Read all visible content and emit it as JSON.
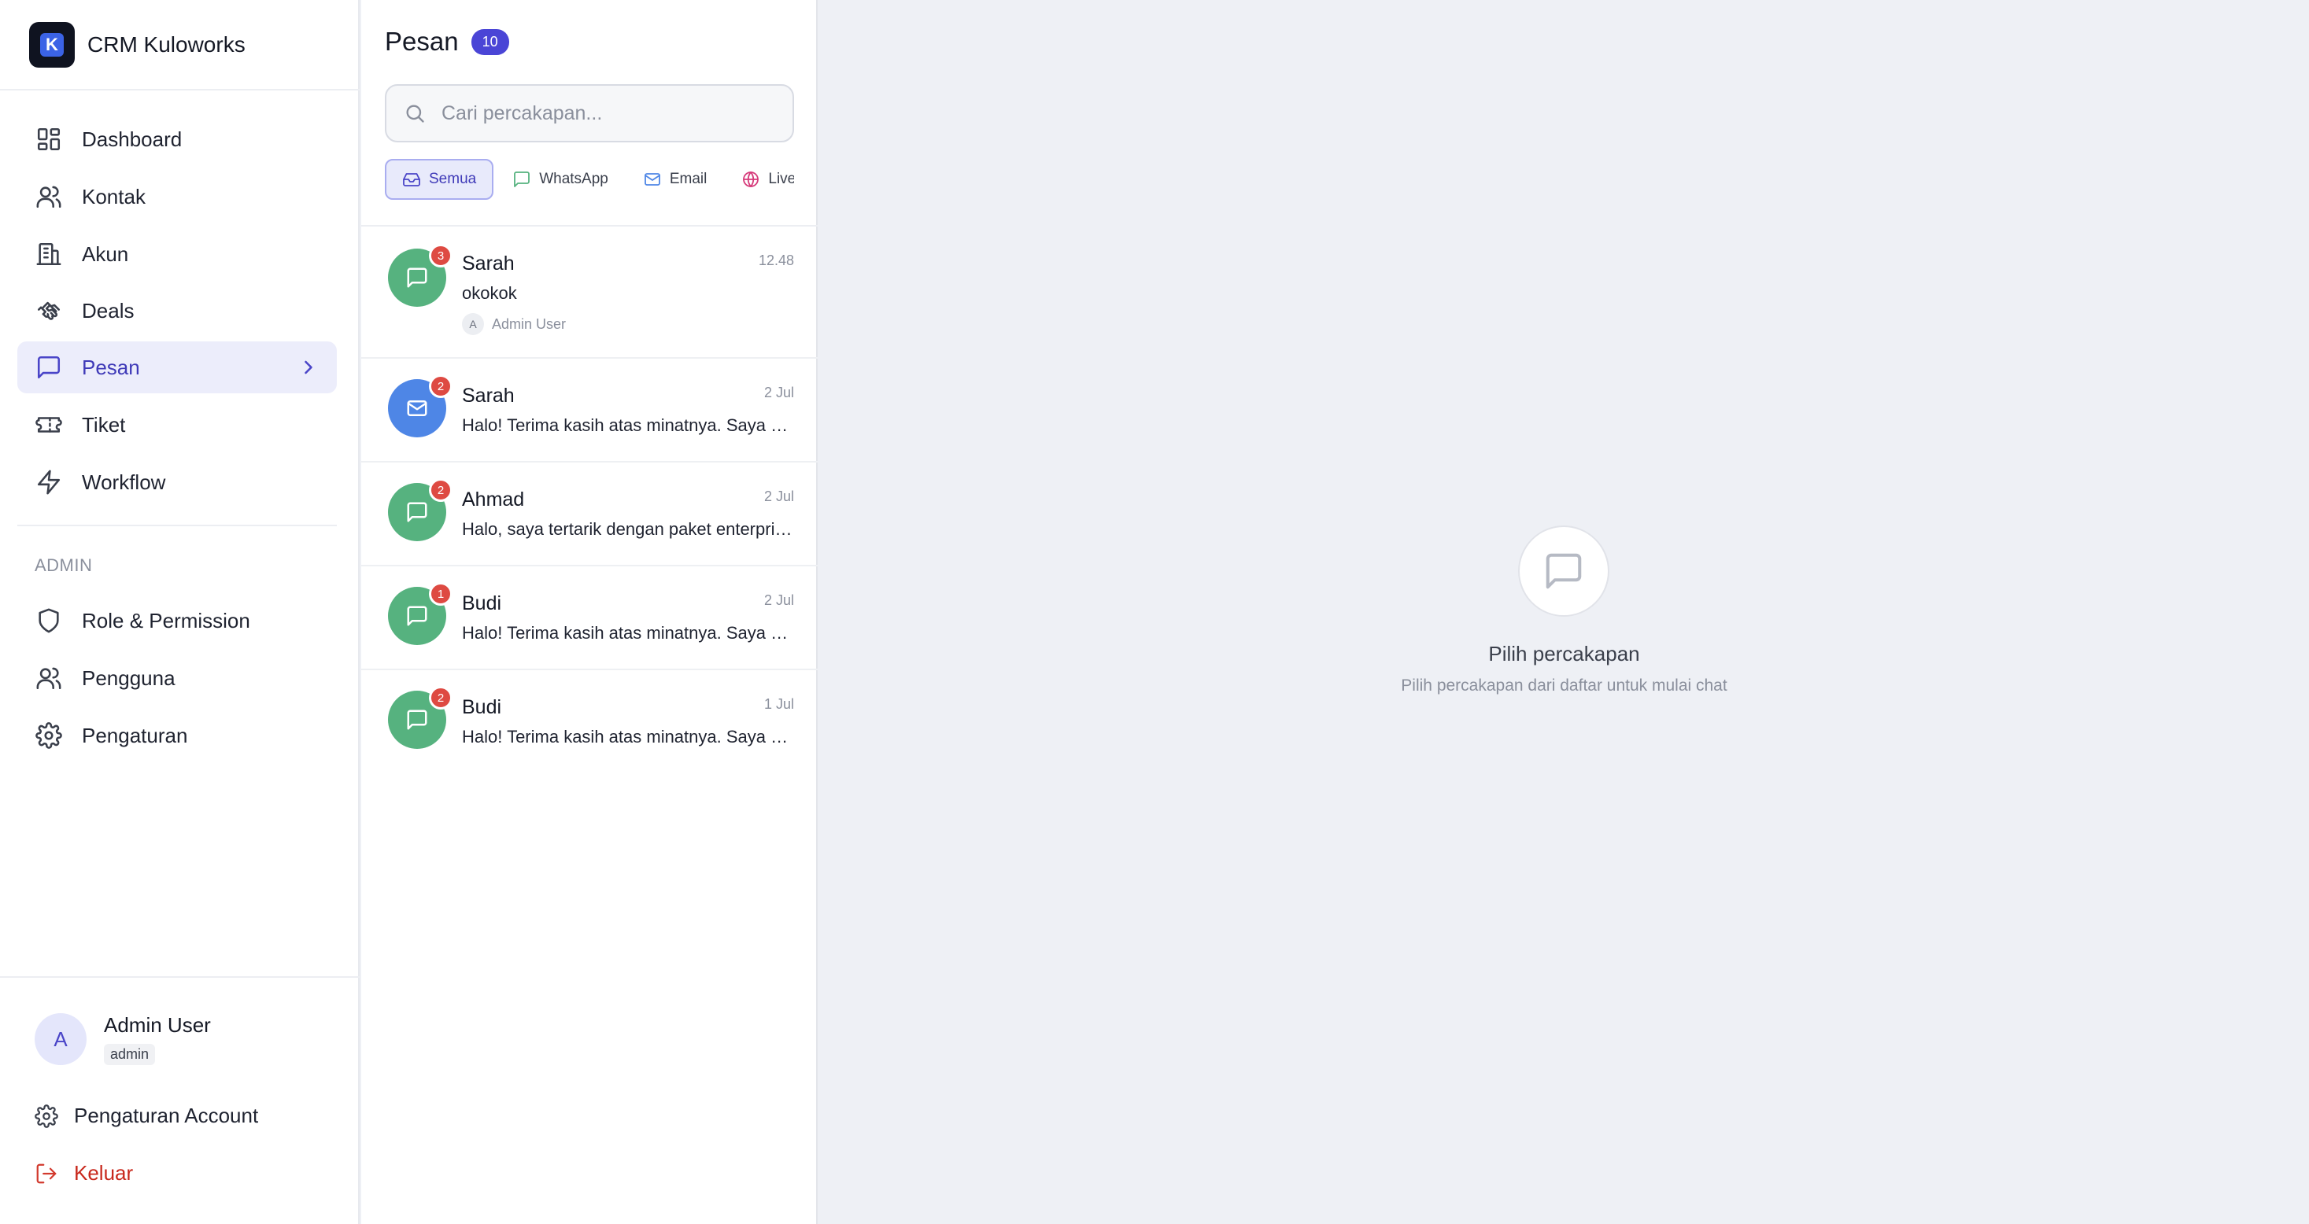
{
  "brand": {
    "logo_letter": "K",
    "name": "CRM Kuloworks"
  },
  "nav": {
    "items": [
      {
        "label": "Dashboard",
        "icon": "dashboard-icon"
      },
      {
        "label": "Kontak",
        "icon": "users-icon"
      },
      {
        "label": "Akun",
        "icon": "building-icon"
      },
      {
        "label": "Deals",
        "icon": "handshake-icon"
      },
      {
        "label": "Pesan",
        "icon": "message-icon",
        "active": true
      },
      {
        "label": "Tiket",
        "icon": "ticket-icon"
      },
      {
        "label": "Workflow",
        "icon": "zap-icon"
      }
    ],
    "admin_section_label": "ADMIN",
    "admin_items": [
      {
        "label": "Role & Permission",
        "icon": "shield-icon"
      },
      {
        "label": "Pengguna",
        "icon": "users-icon"
      },
      {
        "label": "Pengaturan",
        "icon": "gear-icon"
      }
    ]
  },
  "user": {
    "initial": "A",
    "name": "Admin User",
    "role": "admin"
  },
  "footer": {
    "account_settings": "Pengaturan Account",
    "logout": "Keluar"
  },
  "messages": {
    "title": "Pesan",
    "count": "10",
    "search_placeholder": "Cari percakapan...",
    "filters": [
      {
        "label": "Semua",
        "icon": "inbox-icon",
        "active": true
      },
      {
        "label": "WhatsApp",
        "icon": "message-icon"
      },
      {
        "label": "Email",
        "icon": "mail-icon"
      },
      {
        "label": "Live Chat",
        "icon": "globe-icon"
      }
    ],
    "conversations": [
      {
        "name": "Sarah",
        "time": "12.48",
        "preview": "okokok",
        "unread": "3",
        "channel": "whatsapp",
        "assignee_initial": "A",
        "assignee": "Admin User"
      },
      {
        "name": "Sarah",
        "time": "2 Jul",
        "preview": "Halo! Terima kasih atas minatnya. Saya bisa membantu Anda",
        "unread": "2",
        "channel": "email"
      },
      {
        "name": "Ahmad",
        "time": "2 Jul",
        "preview": "Halo, saya tertarik dengan paket enterprise Anda",
        "unread": "2",
        "channel": "whatsapp"
      },
      {
        "name": "Budi",
        "time": "2 Jul",
        "preview": "Halo! Terima kasih atas minatnya. Saya bisa membantu Anda",
        "unread": "1",
        "channel": "whatsapp"
      },
      {
        "name": "Budi",
        "time": "1 Jul",
        "preview": "Halo! Terima kasih atas minatnya. Saya bisa membantu Anda",
        "unread": "2",
        "channel": "whatsapp"
      }
    ]
  },
  "empty_state": {
    "icon": "message-icon",
    "title": "Pilih percakapan",
    "subtitle": "Pilih percakapan dari daftar untuk mulai chat"
  },
  "colors": {
    "accent": "#4a45d6",
    "whatsapp": "#56b27f",
    "email": "#4e86e6",
    "unread": "#de4a42",
    "logout": "#c8281c"
  }
}
